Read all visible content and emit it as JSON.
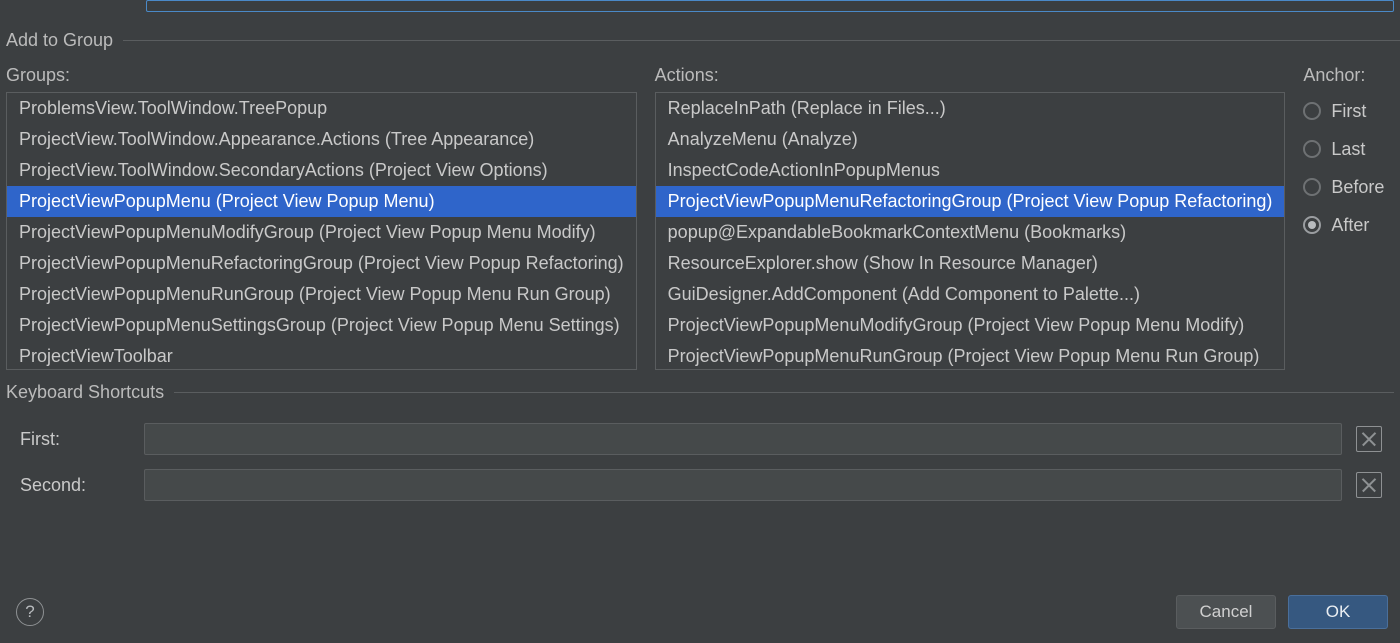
{
  "sections": {
    "add_to_group": "Add to Group",
    "keyboard_shortcuts": "Keyboard Shortcuts"
  },
  "groups": {
    "label": "Groups:",
    "items": [
      "ProblemsView.ToolWindow.TreePopup",
      "ProjectView.ToolWindow.Appearance.Actions (Tree Appearance)",
      "ProjectView.ToolWindow.SecondaryActions (Project View Options)",
      "ProjectViewPopupMenu (Project View Popup Menu)",
      "ProjectViewPopupMenuModifyGroup (Project View Popup Menu Modify)",
      "ProjectViewPopupMenuRefactoringGroup (Project View Popup Refactoring)",
      "ProjectViewPopupMenuRunGroup (Project View Popup Menu Run Group)",
      "ProjectViewPopupMenuSettingsGroup (Project View Popup Menu Settings)",
      "ProjectViewToolbar"
    ],
    "selected_index": 3
  },
  "actions": {
    "label": "Actions:",
    "items": [
      "ReplaceInPath (Replace in Files...)",
      "AnalyzeMenu (Analyze)",
      "InspectCodeActionInPopupMenus",
      "ProjectViewPopupMenuRefactoringGroup (Project View Popup Refactoring)",
      "popup@ExpandableBookmarkContextMenu (Bookmarks)",
      "ResourceExplorer.show (Show In Resource Manager)",
      "GuiDesigner.AddComponent (Add Component to Palette...)",
      "ProjectViewPopupMenuModifyGroup (Project View Popup Menu Modify)",
      "ProjectViewPopupMenuRunGroup (Project View Popup Menu Run Group)"
    ],
    "selected_index": 3
  },
  "anchor": {
    "label": "Anchor:",
    "options": [
      "First",
      "Last",
      "Before",
      "After"
    ],
    "selected_index": 3
  },
  "shortcuts": {
    "first_label": "First:",
    "second_label": "Second:",
    "first_value": "",
    "second_value": ""
  },
  "footer": {
    "cancel": "Cancel",
    "ok": "OK",
    "help": "?"
  }
}
